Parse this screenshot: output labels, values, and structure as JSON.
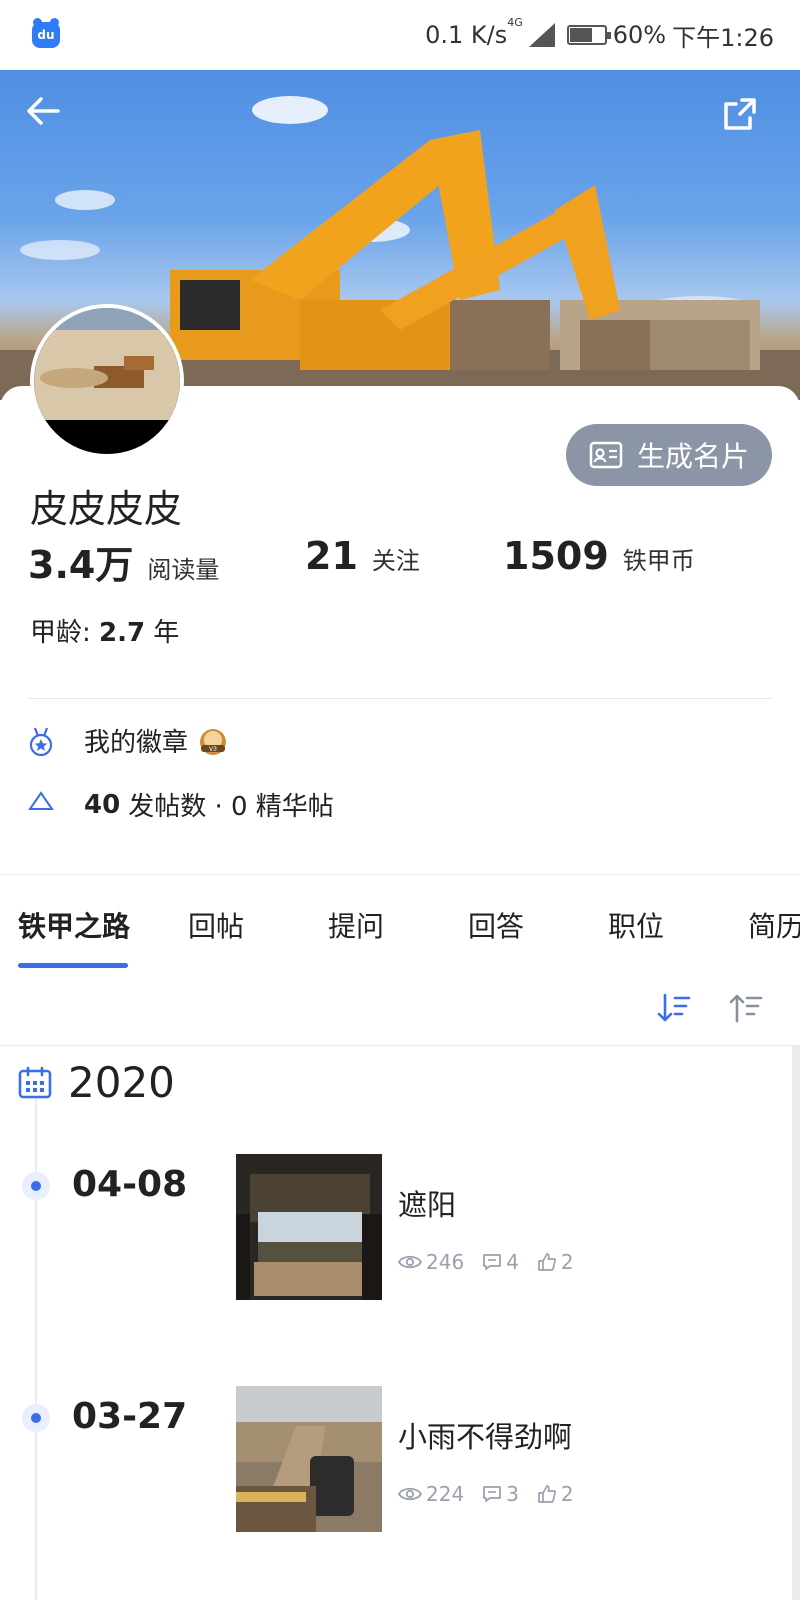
{
  "status_bar": {
    "app_icon_text": "du",
    "net_speed": "0.1 K/s",
    "net_type": "4G",
    "battery": "60%",
    "time": "下午1:26"
  },
  "header": {
    "back_icon": "arrow-left-icon",
    "share_icon": "share-icon"
  },
  "profile": {
    "generate_card_label": "生成名片",
    "username": "皮皮皮皮",
    "stats": [
      {
        "value": "3.4万",
        "label": "阅读量"
      },
      {
        "value": "21",
        "label": "关注"
      },
      {
        "value": "1509",
        "label": "铁甲币"
      }
    ],
    "tenure_label": "甲龄:",
    "tenure_value": "2.7",
    "tenure_unit": "年",
    "badge_label": "我的徽章",
    "badge_level": "V3",
    "post_count": "40",
    "post_count_label": "发帖数 · 0 精华帖"
  },
  "tabs": [
    "铁甲之路",
    "回帖",
    "提问",
    "回答",
    "职位",
    "简历"
  ],
  "active_tab": 0,
  "timeline": {
    "year": "2020",
    "entries": [
      {
        "date": "04-08",
        "title": "遮阳",
        "views": "246",
        "comments": "4",
        "likes": "2"
      },
      {
        "date": "03-27",
        "title": "小雨不得劲啊",
        "views": "224",
        "comments": "3",
        "likes": "2"
      }
    ]
  },
  "colors": {
    "accent": "#3a6de8",
    "card_button": "#8c95a6"
  }
}
